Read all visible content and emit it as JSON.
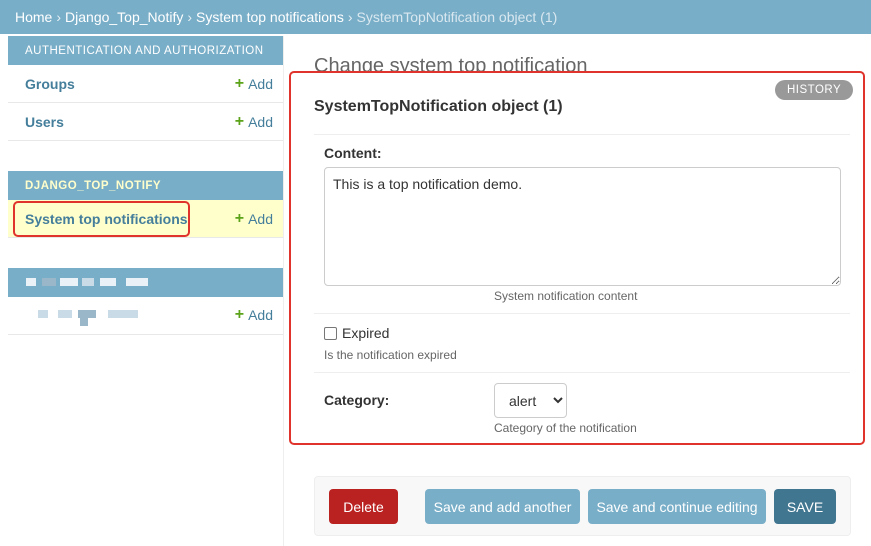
{
  "breadcrumbs": {
    "home": "Home",
    "app": "Django_Top_Notify",
    "model": "System top notifications",
    "current": "SystemTopNotification object (1)",
    "separator": "›"
  },
  "sidebar": {
    "auth_caption": "AUTHENTICATION AND AUTHORIZATION",
    "auth_items": [
      {
        "label": "Groups",
        "add": "Add"
      },
      {
        "label": "Users",
        "add": "Add"
      }
    ],
    "app_caption": "DJANGO_TOP_NOTIFY",
    "app_items": [
      {
        "label": "System top notifications",
        "add": "Add"
      }
    ],
    "redacted_item_add": "Add"
  },
  "main": {
    "page_title": "Change system top notification",
    "history": "HISTORY",
    "object_title": "SystemTopNotification object (1)",
    "content_label": "Content:",
    "content_value": "This is a top notification demo.",
    "content_help": "System notification content",
    "expired_label": "Expired",
    "expired_checked": false,
    "expired_help": "Is the notification expired",
    "category_label": "Category:",
    "category_value": "alert",
    "category_help": "Category of the notification"
  },
  "actions": {
    "delete": "Delete",
    "save_add_another": "Save and add another",
    "save_continue": "Save and continue editing",
    "save": "SAVE"
  },
  "colors": {
    "header": "#79aec8",
    "link": "#447e9b",
    "delete": "#ba2121",
    "secondary": "#79aec8",
    "primary": "#417690",
    "highlight": "#e0332b"
  }
}
